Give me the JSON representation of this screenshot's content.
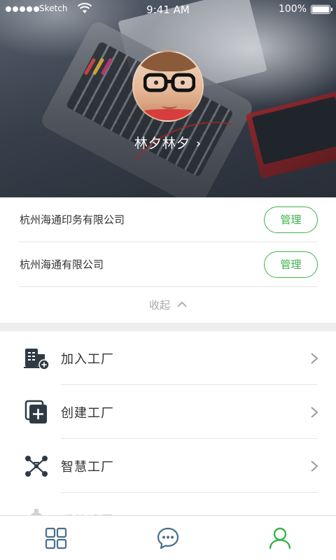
{
  "status_bar": {
    "carrier": "Sketch",
    "time": "9:41 AM",
    "battery": "100%"
  },
  "profile": {
    "name": "林夕林夕",
    "name_chevron": "›"
  },
  "companies": [
    {
      "name": "杭州海通印务有限公司",
      "action": "管理"
    },
    {
      "name": "杭州海通有限公司",
      "action": "管理"
    }
  ],
  "collapse": {
    "label": "收起"
  },
  "menu": [
    {
      "label": "加入工厂",
      "icon": "join-factory-icon"
    },
    {
      "label": "创建工厂",
      "icon": "create-factory-icon"
    },
    {
      "label": "智慧工厂",
      "icon": "smart-factory-icon"
    },
    {
      "label": "系统设置",
      "icon": "settings-icon"
    }
  ],
  "tab_bar": {
    "tabs": [
      {
        "icon": "grid-icon",
        "active": false
      },
      {
        "icon": "chat-icon",
        "active": false
      },
      {
        "icon": "user-icon",
        "active": true
      }
    ]
  },
  "colors": {
    "accent": "#3cb34a",
    "tab_inactive": "#4a6f8a",
    "text": "#333333"
  }
}
